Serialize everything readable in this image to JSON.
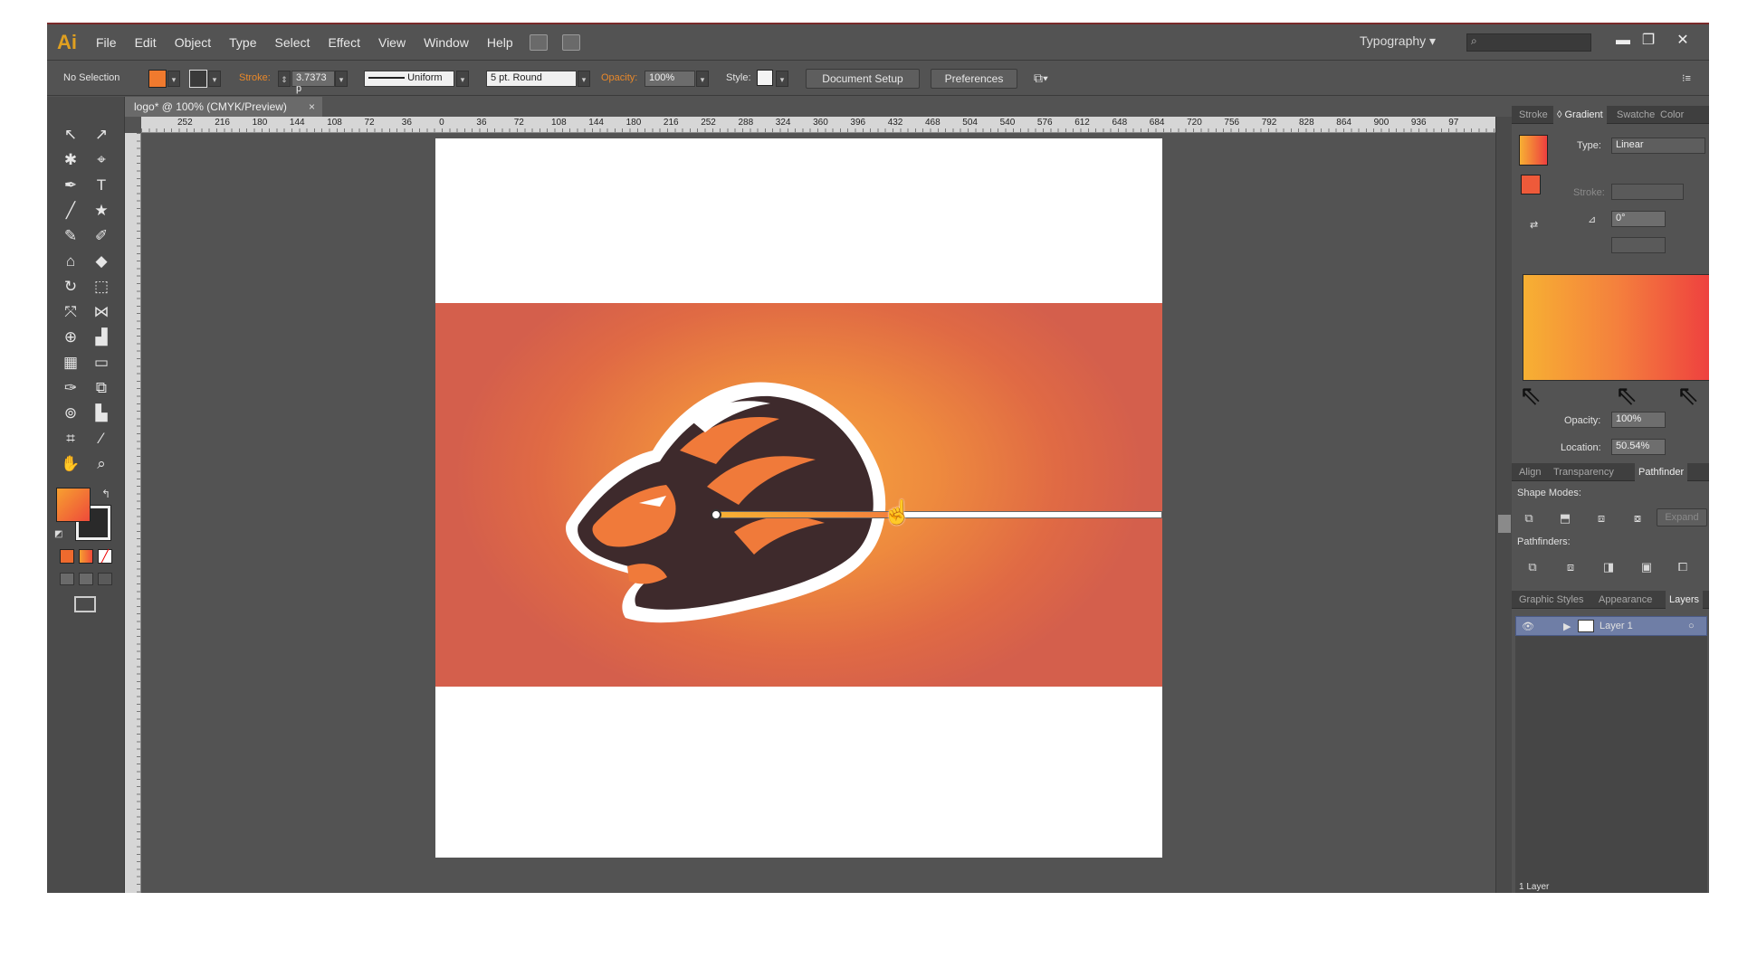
{
  "app": {
    "logo": "Ai",
    "workspace": "Typography ▾"
  },
  "menu": [
    "File",
    "Edit",
    "Object",
    "Type",
    "Select",
    "Effect",
    "View",
    "Window",
    "Help"
  ],
  "window_controls": {
    "minimize": "▬",
    "restore": "❐",
    "close": "✕"
  },
  "search": {
    "placeholder": "⌕"
  },
  "control_bar": {
    "selection": "No Selection",
    "stroke_label": "Stroke:",
    "stroke_weight": "3.7373 p",
    "stroke_profile": "Uniform",
    "brush": "5 pt. Round",
    "opacity_label": "Opacity:",
    "opacity_value": "100%",
    "style_label": "Style:",
    "document_setup": "Document Setup",
    "preferences": "Preferences",
    "fill_color": "#f07a2e"
  },
  "document_tab": {
    "title": "logo* @ 100% (CMYK/Preview)",
    "close": "×"
  },
  "ruler_labels": [
    "252",
    "216",
    "180",
    "144",
    "108",
    "72",
    "36",
    "0",
    "36",
    "72",
    "108",
    "144",
    "180",
    "216",
    "252",
    "288",
    "324",
    "360",
    "396",
    "432",
    "468",
    "504",
    "540",
    "576",
    "612",
    "648",
    "684",
    "720",
    "756",
    "792",
    "828",
    "864",
    "900",
    "936",
    "97"
  ],
  "toolbox": {
    "tools": [
      "↖",
      "↗",
      "✱",
      "⌖",
      "✒",
      "T",
      "╱",
      "★",
      "✎",
      "✐",
      "⌂",
      "◆",
      "↻",
      "⬚",
      "⤧",
      "⋈",
      "⊕",
      "▟",
      "▦",
      "▭",
      "✑",
      "⧉",
      "⊚",
      "▙",
      "⌗",
      "⁄",
      "✋",
      "⌕"
    ],
    "fill_color": "#f06a3a"
  },
  "gradient_panel": {
    "tabs": [
      "Stroke",
      "◊ Gradient",
      "Swatche",
      "Color"
    ],
    "type_label": "Type:",
    "type_value": "Linear",
    "stroke_label": "Stroke:",
    "angle": "0°",
    "opacity_label": "Opacity:",
    "opacity_value": "100%",
    "location_label": "Location:",
    "location_value": "50.54%",
    "colors": [
      "#f7b033",
      "#f4803d",
      "#ee3f3f"
    ]
  },
  "pathfinder_panel": {
    "tabs": [
      "Align",
      "Transparency",
      "Pathfinder"
    ],
    "shape_modes_label": "Shape Modes:",
    "expand": "Expand",
    "pathfinders_label": "Pathfinders:"
  },
  "layers_panel": {
    "tabs": [
      "Graphic Styles",
      "Appearance",
      "Layers"
    ],
    "layer_name": "Layer 1",
    "footer": "1 Layer"
  }
}
